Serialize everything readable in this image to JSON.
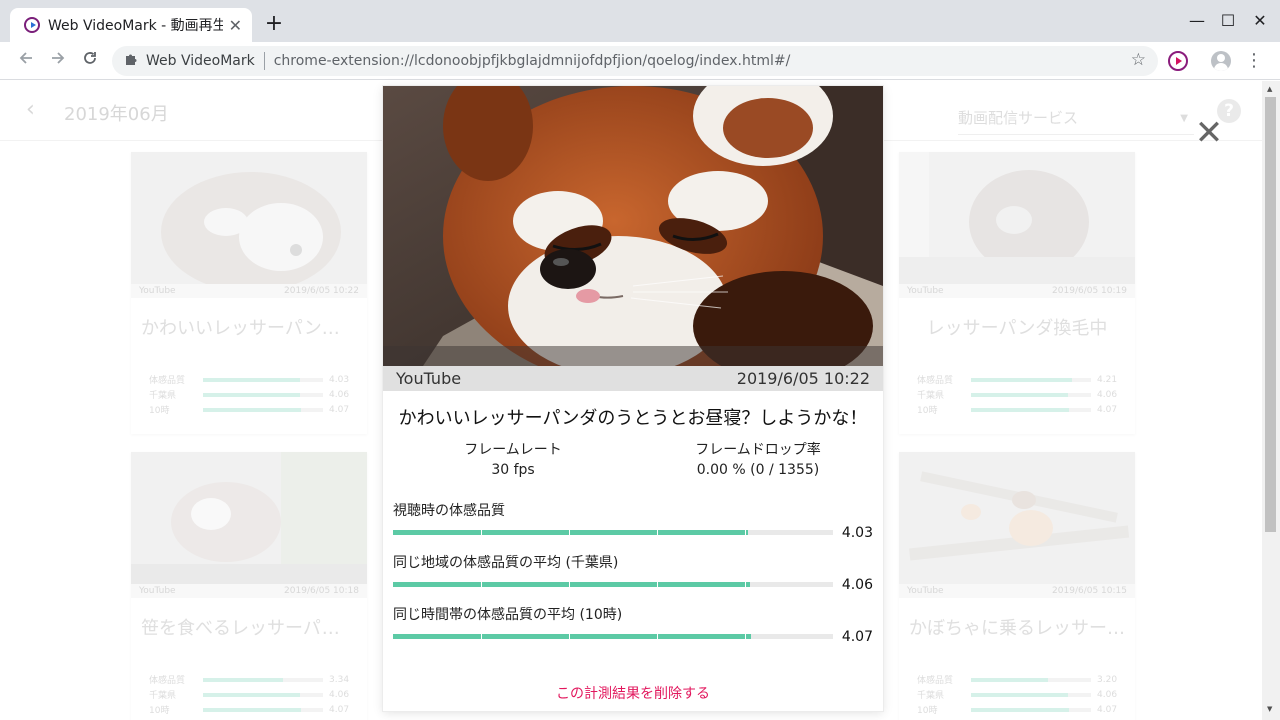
{
  "browser": {
    "tab_title": "Web VideoMark - 動画再生",
    "tab_close": "✕",
    "new_tab": "+",
    "window_controls": {
      "minimize": "—",
      "maximize": "☐",
      "close": "✕"
    },
    "site_label": "Web VideoMark",
    "url": "chrome-extension://lcdonoobjpfjkbglajdmnijofdpfjion/qoelog/index.html#/"
  },
  "app": {
    "month_title": "2019年06月",
    "service_placeholder": "動画配信サービス",
    "help_label": "?"
  },
  "background_cards": [
    {
      "service": "YouTube",
      "date": "2019/6/05 10:22",
      "title": "かわいいレッサーパンダ…",
      "rows": [
        {
          "label": "体感品質",
          "value": "4.03",
          "ratio": 0.806
        },
        {
          "label": "千葉県",
          "value": "4.06",
          "ratio": 0.812
        },
        {
          "label": "10時",
          "value": "4.07",
          "ratio": 0.814
        }
      ]
    },
    {
      "service": "YouTube",
      "date": "2019/6/05 10:19",
      "title": "レッサーパンダ換毛中",
      "rows": [
        {
          "label": "体感品質",
          "value": "4.21",
          "ratio": 0.842
        },
        {
          "label": "千葉県",
          "value": "4.06",
          "ratio": 0.812
        },
        {
          "label": "10時",
          "value": "4.07",
          "ratio": 0.814
        }
      ]
    },
    {
      "service": "YouTube",
      "date": "2019/6/05 10:18",
      "title": "笹を食べるレッサーパンダ",
      "rows": [
        {
          "label": "体感品質",
          "value": "3.34",
          "ratio": 0.668
        },
        {
          "label": "千葉県",
          "value": "4.06",
          "ratio": 0.812
        },
        {
          "label": "10時",
          "value": "4.07",
          "ratio": 0.814
        }
      ]
    },
    {
      "service": "YouTube",
      "date": "2019/6/05 10:15",
      "title": "かぼちゃに乗るレッサー…",
      "rows": [
        {
          "label": "体感品質",
          "value": "3.20",
          "ratio": 0.64
        },
        {
          "label": "千葉県",
          "value": "4.06",
          "ratio": 0.812
        },
        {
          "label": "10時",
          "value": "4.07",
          "ratio": 0.814
        }
      ]
    }
  ],
  "modal": {
    "close_label": "✕",
    "service": "YouTube",
    "date": "2019/6/05 10:22",
    "title": "かわいいレッサーパンダのうとうとお昼寝？しようかな！",
    "framerate_label": "フレームレート",
    "framerate_value": "30 fps",
    "framedrop_label": "フレームドロップ率",
    "framedrop_value": "0.00 % (0 / 1355)",
    "quality": [
      {
        "label": "視聴時の体感品質",
        "value": "4.03",
        "ratio": 0.806
      },
      {
        "label": "同じ地域の体感品質の平均 (千葉県)",
        "value": "4.06",
        "ratio": 0.812
      },
      {
        "label": "同じ時間帯の体感品質の平均 (10時)",
        "value": "4.07",
        "ratio": 0.814
      }
    ],
    "delete_label": "この計測結果を削除する"
  },
  "colors": {
    "accent_green": "#5ccaa5",
    "delete_pink": "#e2175d",
    "chrome_bg": "#dee1e6"
  }
}
